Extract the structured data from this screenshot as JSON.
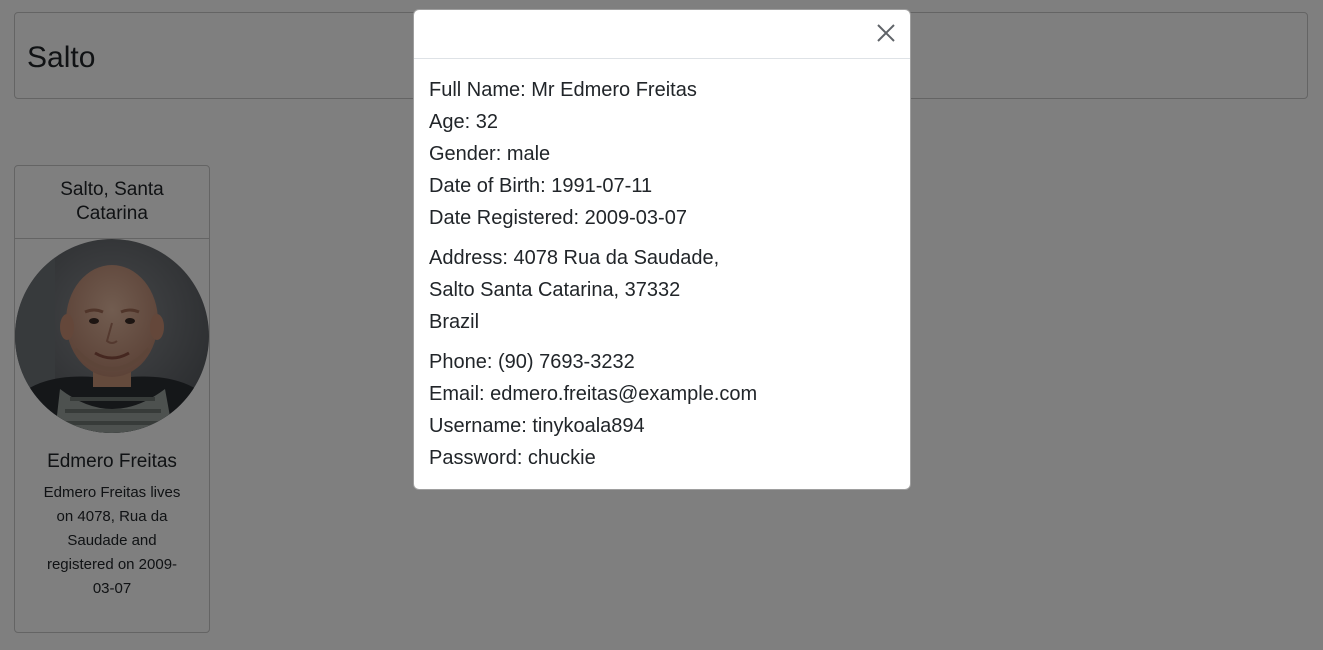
{
  "header": {
    "title": "Salto"
  },
  "card": {
    "location": "Salto, Santa Catarina",
    "avatar_icon": "person-photo-icon",
    "name": "Edmero Freitas",
    "description": "Edmero Freitas lives on 4078, Rua da Saudade and registered on 2009-03-07"
  },
  "modal": {
    "close_icon": "close-icon",
    "full_name": "Full Name: Mr Edmero Freitas",
    "age": "Age: 32",
    "gender": "Gender: male",
    "dob": "Date of Birth: 1991-07-11",
    "registered": "Date Registered: 2009-03-07",
    "address_line1": "Address: 4078 Rua da Saudade,",
    "address_line2": "Salto Santa Catarina, 37332",
    "address_line3": "Brazil",
    "phone": "Phone: (90) 7693-3232",
    "email": "Email: edmero.freitas@example.com",
    "username": "Username: tinykoala894",
    "password": "Password: chuckie"
  },
  "colors": {
    "overlay": "#000000",
    "text": "#212529",
    "border": "#c8c8c8"
  }
}
